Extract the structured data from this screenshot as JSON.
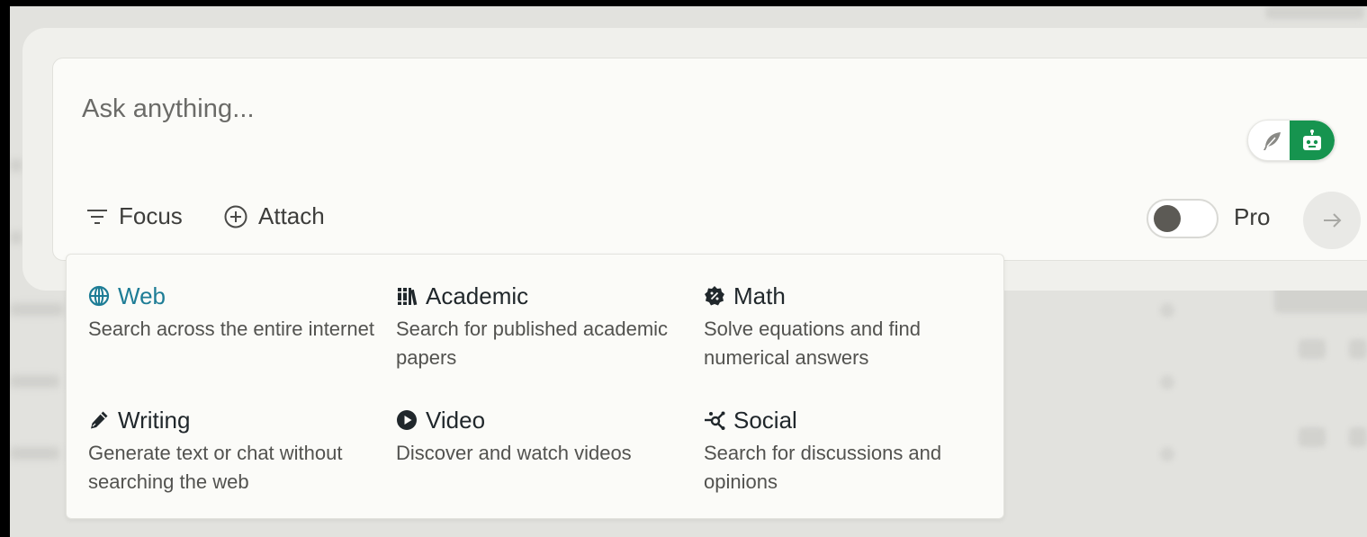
{
  "search": {
    "placeholder": "Ask anything..."
  },
  "toolbar": {
    "focus_label": "Focus",
    "attach_label": "Attach",
    "pro_label": "Pro",
    "pro_enabled": false
  },
  "focus_menu": {
    "options": [
      {
        "title": "Web",
        "description": "Search across the entire internet",
        "icon": "globe-icon",
        "selected": true
      },
      {
        "title": "Academic",
        "description": "Search for published academic papers",
        "icon": "books-icon",
        "selected": false
      },
      {
        "title": "Math",
        "description": "Solve equations and find numerical answers",
        "icon": "math-badge-icon",
        "selected": false
      },
      {
        "title": "Writing",
        "description": "Generate text or chat without searching the web",
        "icon": "pen-icon",
        "selected": false
      },
      {
        "title": "Video",
        "description": "Discover and watch videos",
        "icon": "play-icon",
        "selected": false
      },
      {
        "title": "Social",
        "description": "Search for discussions and opinions",
        "icon": "network-icon",
        "selected": false
      }
    ]
  },
  "colors": {
    "accent": "#1e7d96",
    "model_active": "#16944f",
    "text_primary": "#20272b",
    "text_secondary": "#52524f"
  }
}
